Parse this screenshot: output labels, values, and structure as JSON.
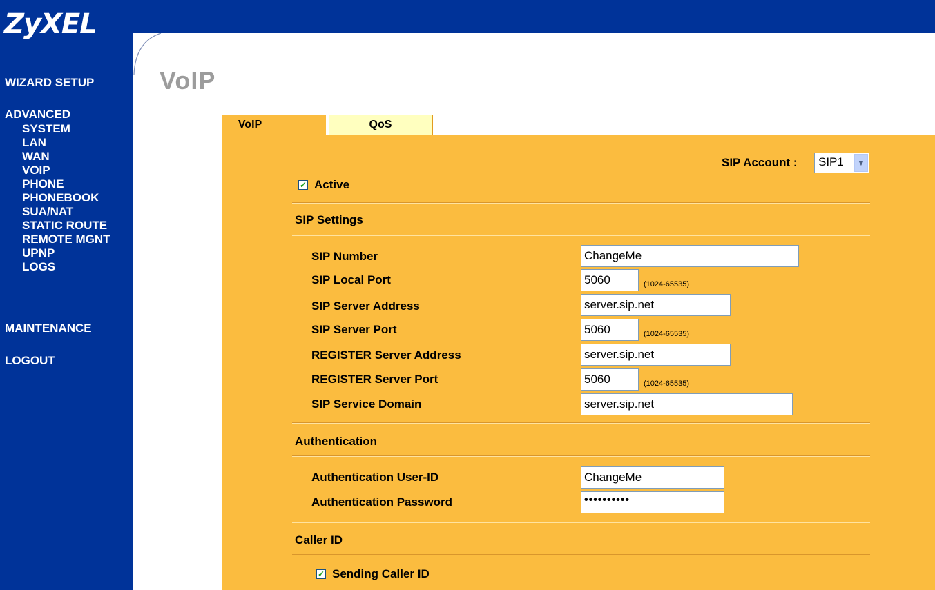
{
  "brand": {
    "logo": "ZyXEL"
  },
  "sidebar": {
    "wizard": "WIZARD SETUP",
    "advanced": "ADVANCED",
    "items": [
      "SYSTEM",
      "LAN",
      "WAN",
      "VOIP",
      "PHONE",
      "PHONEBOOK",
      "SUA/NAT",
      "STATIC ROUTE",
      "REMOTE MGNT",
      "UPNP",
      "LOGS"
    ],
    "maintenance": "MAINTENANCE",
    "logout": "LOGOUT"
  },
  "page": {
    "title": "VoIP"
  },
  "tabs": {
    "voip": "VoIP",
    "qos": "QoS"
  },
  "account": {
    "label": "SIP Account :",
    "value": "SIP1"
  },
  "active": {
    "label": "Active",
    "checked": true
  },
  "sip_settings": {
    "heading": "SIP Settings",
    "sip_number_label": "SIP Number",
    "sip_number": "ChangeMe",
    "local_port_label": "SIP Local Port",
    "local_port": "5060",
    "server_address_label": "SIP Server Address",
    "server_address": "server.sip.net",
    "server_port_label": "SIP Server Port",
    "server_port": "5060",
    "register_address_label": "REGISTER Server Address",
    "register_address": "server.sip.net",
    "register_port_label": "REGISTER Server Port",
    "register_port": "5060",
    "domain_label": "SIP Service Domain",
    "domain": "server.sip.net",
    "port_range": "(1024-65535)"
  },
  "authentication": {
    "heading": "Authentication",
    "user_label": "Authentication User-ID",
    "user": "ChangeMe",
    "password_label": "Authentication Password",
    "password": "••••••••••"
  },
  "caller_id": {
    "heading": "Caller ID",
    "sending_label": "Sending Caller ID",
    "checked": true
  },
  "colors": {
    "sidebar": "#003399",
    "panel": "#fbbc3f",
    "qos_tab": "#ffffbf"
  }
}
